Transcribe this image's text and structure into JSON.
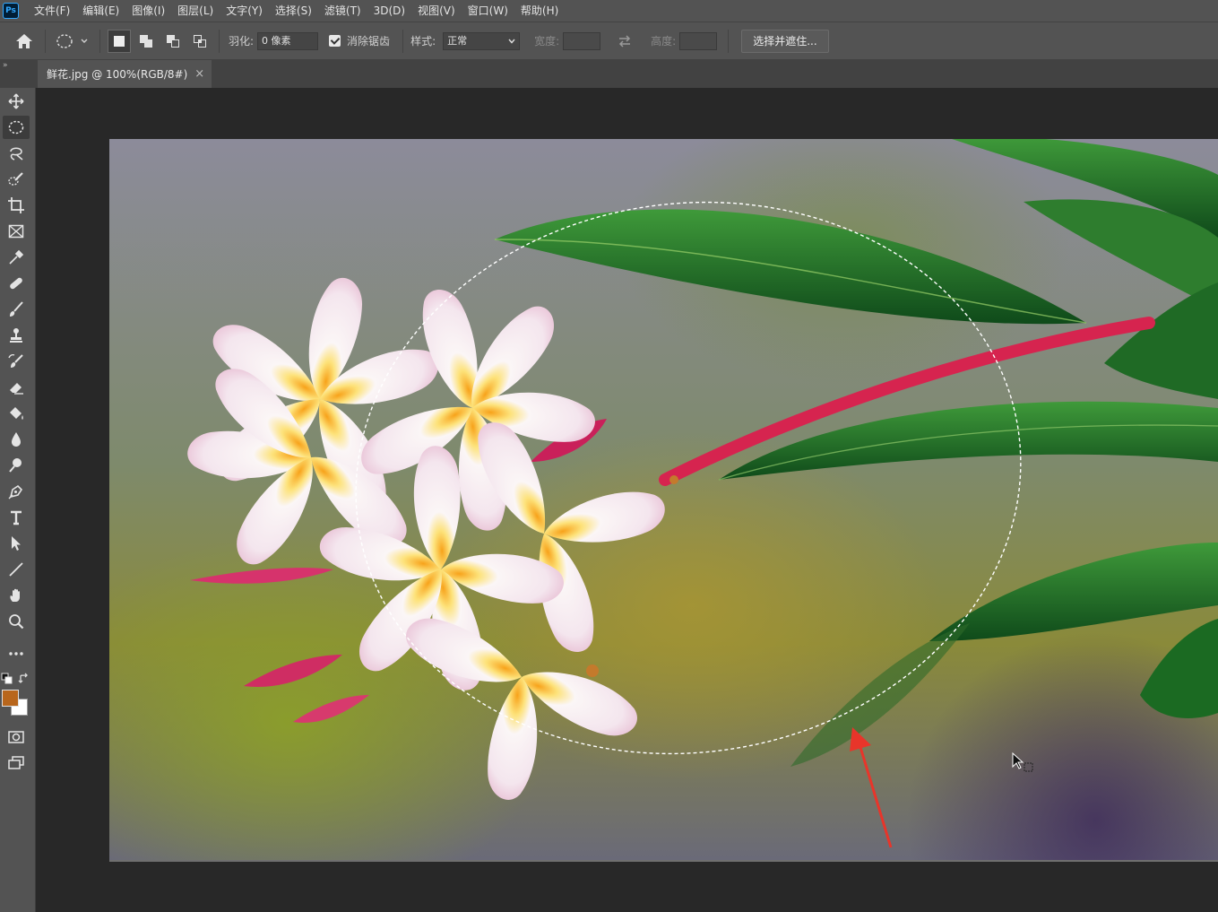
{
  "app": {
    "logo": "Ps"
  },
  "menu": [
    "文件(F)",
    "编辑(E)",
    "图像(I)",
    "图层(L)",
    "文字(Y)",
    "选择(S)",
    "滤镜(T)",
    "3D(D)",
    "视图(V)",
    "窗口(W)",
    "帮助(H)"
  ],
  "options": {
    "feather_label": "羽化:",
    "feather_value": "0 像素",
    "antialias_label": "消除锯齿",
    "antialias_checked": true,
    "style_label": "样式:",
    "style_value": "正常",
    "width_label": "宽度:",
    "height_label": "高度:",
    "select_mask_label": "选择并遮住..."
  },
  "document": {
    "tab_title": "鲜花.jpg @ 100%(RGB/8#)",
    "close_glyph": "×"
  },
  "colors": {
    "foreground": "#b8661c",
    "background": "#ffffff",
    "annotation_arrow": "#e8352a"
  },
  "tools": [
    "move-tool",
    "elliptical-marquee-tool",
    "lasso-tool",
    "quick-selection-tool",
    "crop-tool",
    "frame-tool",
    "eyedropper-tool",
    "healing-brush-tool",
    "brush-tool",
    "clone-stamp-tool",
    "history-brush-tool",
    "eraser-tool",
    "paint-bucket-tool",
    "blur-tool",
    "dodge-tool",
    "pen-tool",
    "type-tool",
    "path-selection-tool",
    "line-tool",
    "hand-tool",
    "zoom-tool",
    "edit-toolbar",
    "quick-mask",
    "screen-mode"
  ],
  "active_tool": "elliptical-marquee-tool"
}
